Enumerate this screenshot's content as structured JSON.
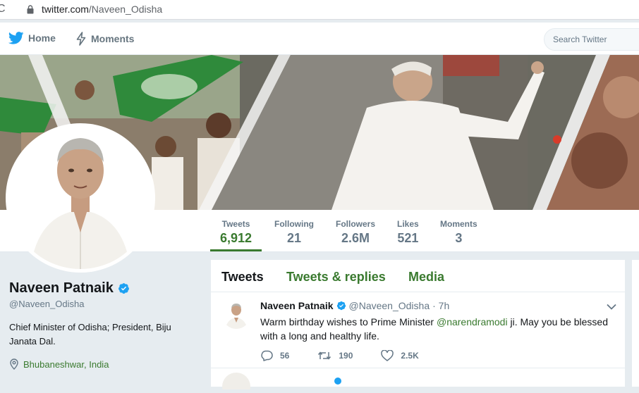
{
  "browser": {
    "url_domain": "twitter.com",
    "url_path": "/Naveen_Odisha"
  },
  "nav": {
    "home": "Home",
    "moments": "Moments",
    "search_placeholder": "Search Twitter"
  },
  "stats": [
    {
      "label": "Tweets",
      "value": "6,912"
    },
    {
      "label": "Following",
      "value": "21"
    },
    {
      "label": "Followers",
      "value": "2.6M"
    },
    {
      "label": "Likes",
      "value": "521"
    },
    {
      "label": "Moments",
      "value": "3"
    }
  ],
  "profile": {
    "name": "Naveen Patnaik",
    "handle": "@Naveen_Odisha",
    "bio": "Chief Minister of Odisha; President, Biju Janata Dal.",
    "location": "Bhubaneshwar, India"
  },
  "tabs": [
    "Tweets",
    "Tweets & replies",
    "Media"
  ],
  "tweet": {
    "name": "Naveen Patnaik",
    "handle": "@Naveen_Odisha",
    "time": "· 7h",
    "text_before": "Warm birthday wishes to Prime Minister ",
    "mention": "@narendramodi",
    "text_after": " ji. May you be blessed with a long and healthy life.",
    "replies": "56",
    "retweets": "190",
    "likes": "2.5K"
  },
  "colors": {
    "accent": "#3a7a2f",
    "twitter_blue": "#1da1f2"
  }
}
